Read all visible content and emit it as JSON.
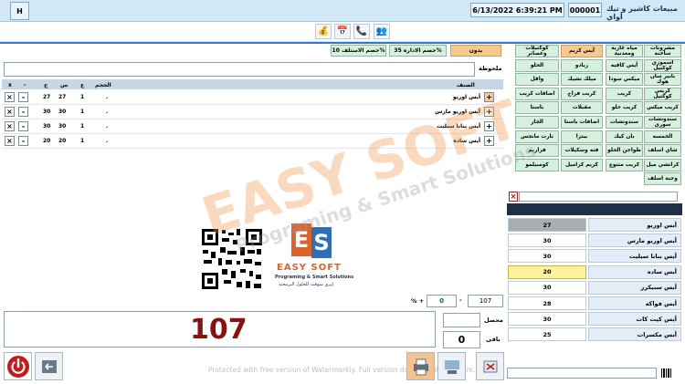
{
  "titlebar": {
    "h_button": "H",
    "title": "مبيعات كاشير و تيك أواي",
    "invoice_no": "000001",
    "datetime": "6/13/2022 6:39:21 PM"
  },
  "categories": [
    [
      "مشروبات ساخنة",
      "مياه غازية ومعدنية",
      "أيس كريم",
      "كوكتيلات وعصائر"
    ],
    [
      "أسموزي كوكتيل",
      "أيس كافيه",
      "زبادو",
      "الحلو"
    ],
    [
      "بابير سان هوك",
      "ميكس سودا",
      "ميلك تشيك",
      "واقل"
    ],
    [
      "كريس كوكتيل",
      "كريب",
      "كريب فراخ",
      "اضافات كريب"
    ],
    [
      "كريب ميكس",
      "كريب حلو",
      "مقبلات",
      "باستا"
    ],
    [
      "سندوتشات سوري",
      "سندوتشات",
      "اضافات باستا",
      "الجار"
    ],
    [
      "الخمسه",
      "بان كيك",
      "بيتزا",
      "تارت مانجس"
    ],
    [
      "شاي اسلف",
      "طواجن الحلو",
      "فته وسكيلات",
      "فراريم"
    ],
    [
      "كراتشي ميل",
      "كريب مثنوع",
      "كريم كراميل",
      "كومبيلمو"
    ],
    [
      "وجبة اسلف"
    ]
  ],
  "active_category": "أيس كريم",
  "discounts": {
    "none": "بدون",
    "admin": "خصم الاداره 35%",
    "staff": "خصم الاستلف 10%"
  },
  "notes_label": "ملحوظة",
  "grid": {
    "headers": {
      "item": "الصنف",
      "size": "الحجم",
      "qty": "ع",
      "price": "س",
      "total": "ج",
      "minus": "-",
      "del": "x"
    },
    "rows": [
      {
        "item": "أيس اوريو",
        "size": ".",
        "qty": "1",
        "price": "27",
        "total": "27"
      },
      {
        "item": "أيس اوريو مارس",
        "size": ".",
        "qty": "1",
        "price": "30",
        "total": "30"
      },
      {
        "item": "أيس بنانا سبليت",
        "size": ".",
        "qty": "1",
        "price": "30",
        "total": "30"
      },
      {
        "item": "أيس ساده",
        "size": ".",
        "qty": "1",
        "price": "20",
        "total": "20"
      }
    ]
  },
  "products": [
    {
      "name": "أيس اوريو",
      "price": "27",
      "state": "gray"
    },
    {
      "name": "أيس اوريو مارس",
      "price": "30",
      "state": "normal"
    },
    {
      "name": "أيس بنانا سبليت",
      "price": "30",
      "state": "normal"
    },
    {
      "name": "أيس ساده",
      "price": "20",
      "state": "yellow"
    },
    {
      "name": "أيس سنيكرز",
      "price": "30",
      "state": "normal"
    },
    {
      "name": "أيس فواكه",
      "price": "28",
      "state": "normal"
    },
    {
      "name": "أيس كيت كات",
      "price": "30",
      "state": "normal"
    },
    {
      "name": "أيس مكسرات",
      "price": "25",
      "state": "normal"
    }
  ],
  "totals": {
    "subtotal": "107",
    "discount_value": "0",
    "percent_label": "% +",
    "dash": "-",
    "big_total": "107",
    "paid_label": "محصل",
    "remain_label": "باقى",
    "remain_value": "0"
  },
  "logo": {
    "line1": "EASY SOFT",
    "line2": "Programing & Smart Solutions",
    "line3": "إيزي سوفت للحلول البرمجية",
    "letters_e": "E",
    "letters_s": "S"
  },
  "watermark_notice": "Protected with free version of Watermarkly. Full version doesn't put this mark.",
  "bottom": {
    "small_btn_label": "طباعة",
    "left_btn_label": "حذف"
  },
  "colors": {
    "accent": "#2f7ad0",
    "category_bg": "#d6f0de",
    "active_bg": "#f7c98f",
    "total_red": "#8b1010",
    "header_blue": "#1f2f45"
  }
}
